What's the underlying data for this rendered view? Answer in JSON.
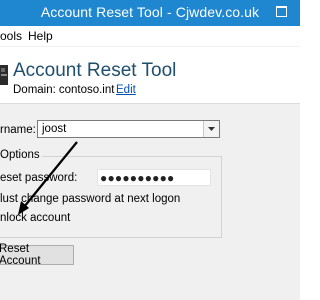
{
  "window": {
    "title": "Account Reset Tool - Cjwdev.co.uk",
    "title_bar_color": "#1f86d0"
  },
  "menu": {
    "items": [
      {
        "label": "ools"
      },
      {
        "label": "Help"
      }
    ]
  },
  "header": {
    "app_title": "Account Reset Tool",
    "domain_label": "Domain:",
    "domain_value": "contoso.int",
    "edit_link": "Edit",
    "title_color": "#1f4e6e",
    "link_color": "#0050b0"
  },
  "form": {
    "username_label": "rname:",
    "username_value": "joost",
    "options_label": "Options",
    "reset_password_label": "eset password:",
    "password_value": "●●●●●●●●●●",
    "must_change_label": "lust change password at next logon",
    "unlock_label": "nlock account",
    "reset_button_label": "Reset Account"
  },
  "annotation": {
    "icon": "arrow-icon",
    "color": "#000000"
  }
}
